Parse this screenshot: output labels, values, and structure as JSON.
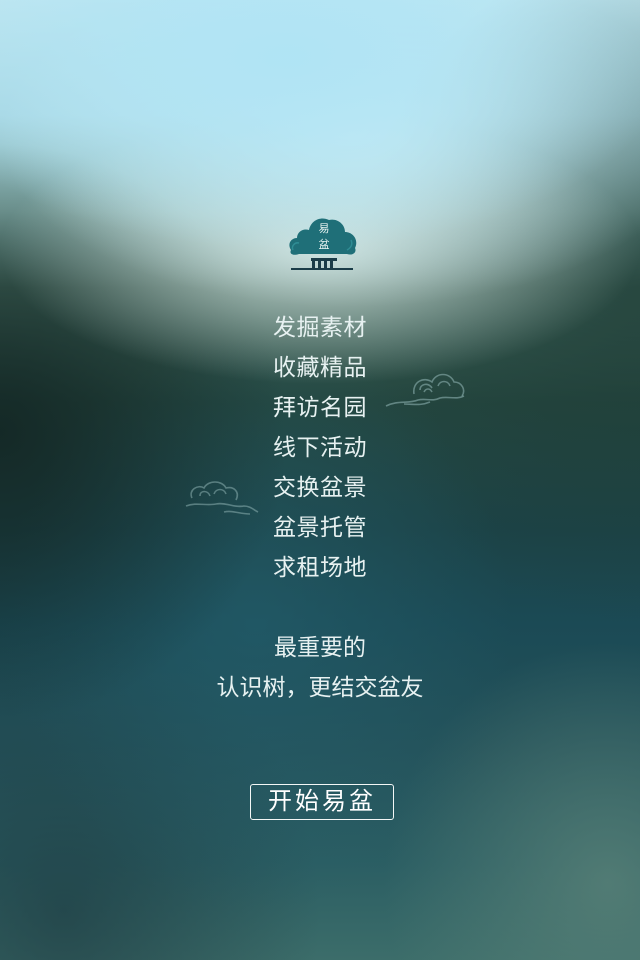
{
  "logo": {
    "name": "tree-logo-icon",
    "text_top": "易",
    "text_bottom": "盆"
  },
  "features": [
    "发掘素材",
    "收藏精品",
    "拜访名园",
    "线下活动",
    "交换盆景",
    "盆景托管",
    "求租场地"
  ],
  "tagline": {
    "line1": "最重要的",
    "line2": "认识树，更结交盆友"
  },
  "start_button": {
    "label": "开始易盆"
  },
  "colors": {
    "logo_teal": "#1f6f78",
    "text": "#e7f1f1",
    "button_border": "#f3f7f6"
  }
}
